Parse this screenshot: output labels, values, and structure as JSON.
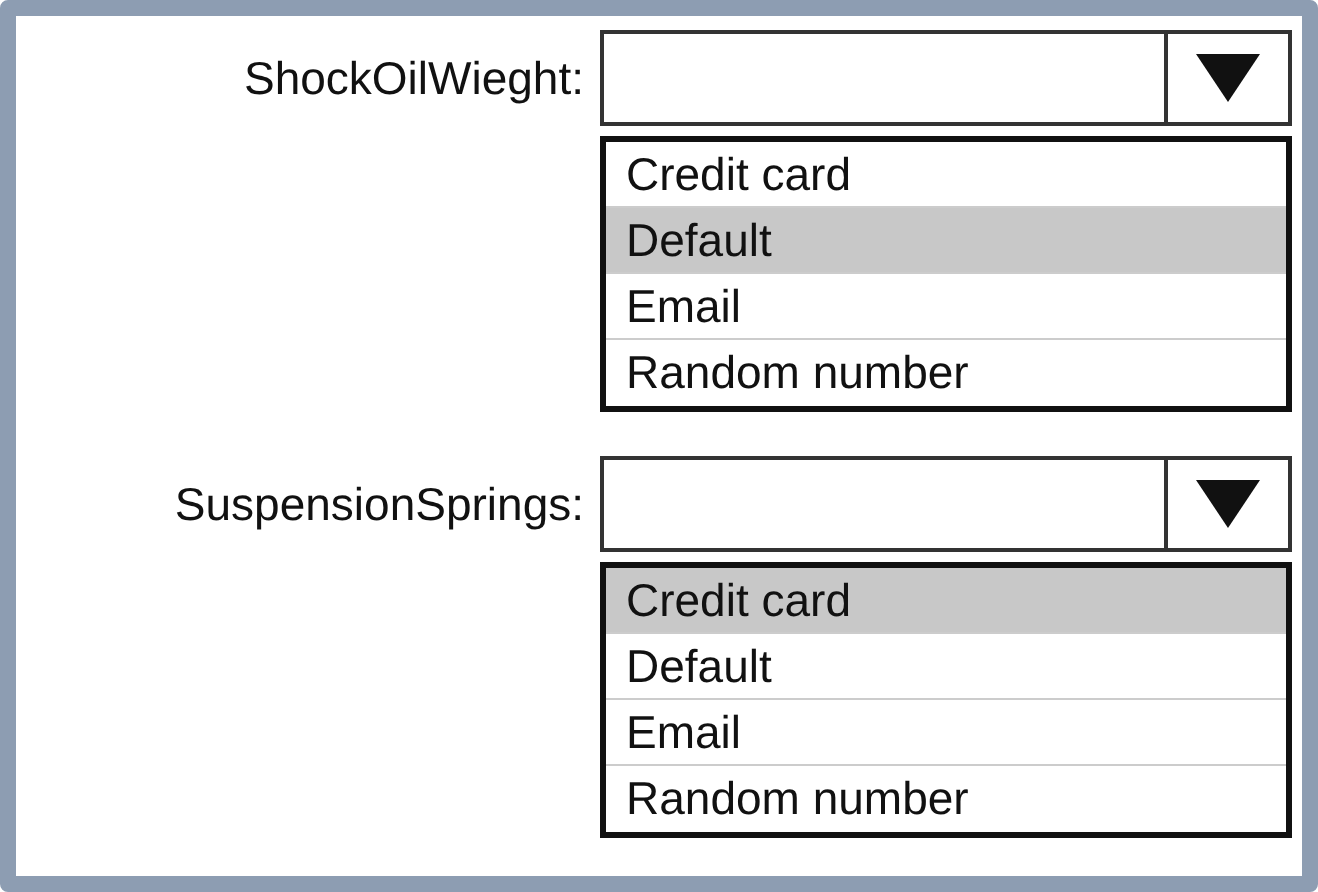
{
  "dropdowns": [
    {
      "label": "ShockOilWieght:",
      "options": [
        {
          "label": "Credit card",
          "selected": false
        },
        {
          "label": "Default",
          "selected": true
        },
        {
          "label": "Email",
          "selected": false
        },
        {
          "label": "Random number",
          "selected": false
        }
      ]
    },
    {
      "label": "SuspensionSprings:",
      "options": [
        {
          "label": "Credit card",
          "selected": true
        },
        {
          "label": "Default",
          "selected": false
        },
        {
          "label": "Email",
          "selected": false
        },
        {
          "label": "Random number",
          "selected": false
        }
      ]
    }
  ]
}
